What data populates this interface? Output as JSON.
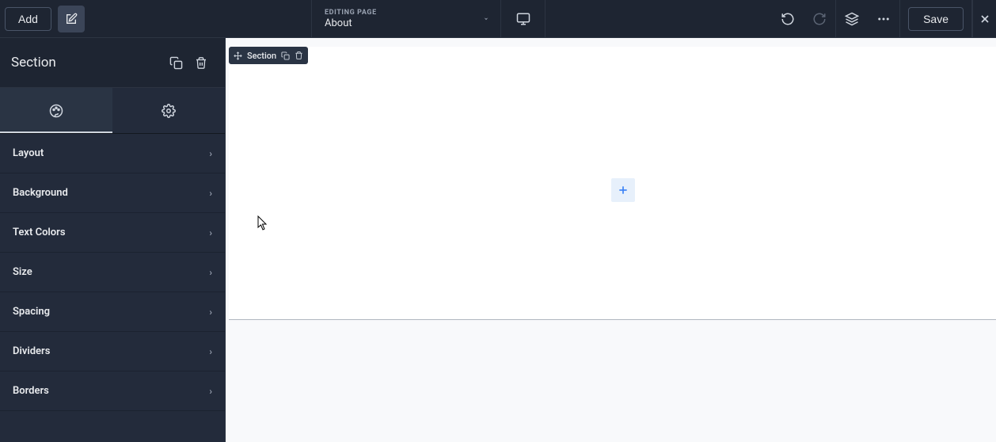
{
  "topbar": {
    "add_label": "Add",
    "editing_page_label": "EDITING PAGE",
    "page_name": "About",
    "save_label": "Save"
  },
  "sidebar": {
    "title": "Section",
    "panels": [
      {
        "label": "Layout"
      },
      {
        "label": "Background"
      },
      {
        "label": "Text Colors"
      },
      {
        "label": "Size"
      },
      {
        "label": "Spacing"
      },
      {
        "label": "Dividers"
      },
      {
        "label": "Borders"
      }
    ]
  },
  "canvas": {
    "section_label": "Section"
  },
  "icons": {
    "edit": "edit-icon",
    "desktop": "desktop-icon",
    "undo": "undo-icon",
    "redo": "redo-icon",
    "layers": "layers-icon",
    "more": "more-icon",
    "close": "close-icon",
    "duplicate": "duplicate-icon",
    "trash": "trash-icon",
    "style": "palette-icon",
    "settings": "gear-icon",
    "move": "move-icon"
  }
}
